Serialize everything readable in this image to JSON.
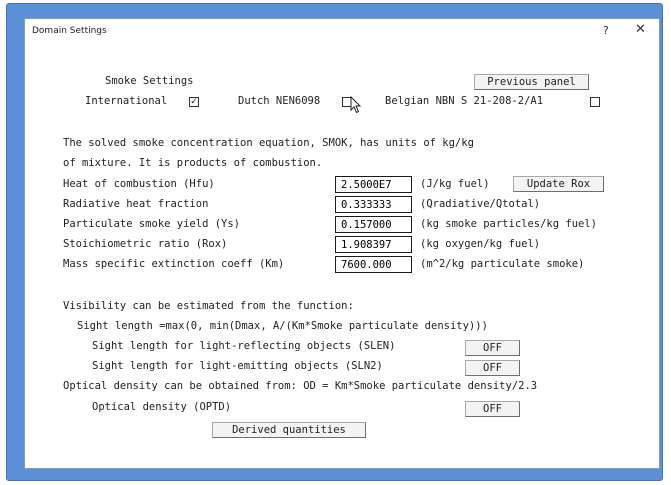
{
  "window": {
    "title": "Domain Settings",
    "help_icon": "question-mark-icon",
    "help_glyph": "?",
    "close_icon": "close-x-icon",
    "close_glyph": "✕"
  },
  "smoke_settings": {
    "heading": "Smoke Settings",
    "previous_panel_label": "Previous panel",
    "international_label": "International",
    "international_checked": true,
    "dutch_label": "Dutch NEN6098",
    "dutch_checked": false,
    "belgian_label": "Belgian NBN S 21-208-2/A1",
    "belgian_checked": false
  },
  "equation_text": {
    "line1": "The solved smoke concentration equation, SMOK, has units of kg/kg",
    "line2": "of mixture. It is products of combustion."
  },
  "fields": [
    {
      "label": "Heat of combustion (Hfu)",
      "value": "2.5000E7",
      "unit": "(J/kg fuel)"
    },
    {
      "label": "Radiative heat fraction",
      "value": "0.333333",
      "unit": "(Qradiative/Qtotal)"
    },
    {
      "label": "Particulate smoke yield (Ys)",
      "value": "0.157000",
      "unit": "(kg smoke particles/kg fuel)"
    },
    {
      "label": "Stoichiometric ratio (Rox)",
      "value": "1.908397",
      "unit": "(kg oxygen/kg fuel)"
    },
    {
      "label": "Mass specific extinction coeff (Km)",
      "value": "7600.000",
      "unit": "(m^2/kg particulate smoke)"
    }
  ],
  "update_rox_label": "Update Rox",
  "visibility": {
    "intro": "Visibility can be estimated from the function:",
    "formula": "Sight length =max(0, min(Dmax, A/(Km*Smoke particulate density)))",
    "slen_label": "Sight length for light-reflecting objects (SLEN)",
    "slen_value": "OFF",
    "sln2_label": "Sight length for light-emitting objects (SLN2)",
    "sln2_value": "OFF"
  },
  "optical": {
    "intro": "Optical density can be obtained from: OD = Km*Smoke particulate density/2.3",
    "optd_label": "Optical density (OPTD)",
    "optd_value": "OFF"
  },
  "derived_quantities_label": "Derived quantities",
  "colors": {
    "frame_blue": "#5b8fd6",
    "window_bg": "#ffffff",
    "button_bg": "#f3f3f3"
  }
}
